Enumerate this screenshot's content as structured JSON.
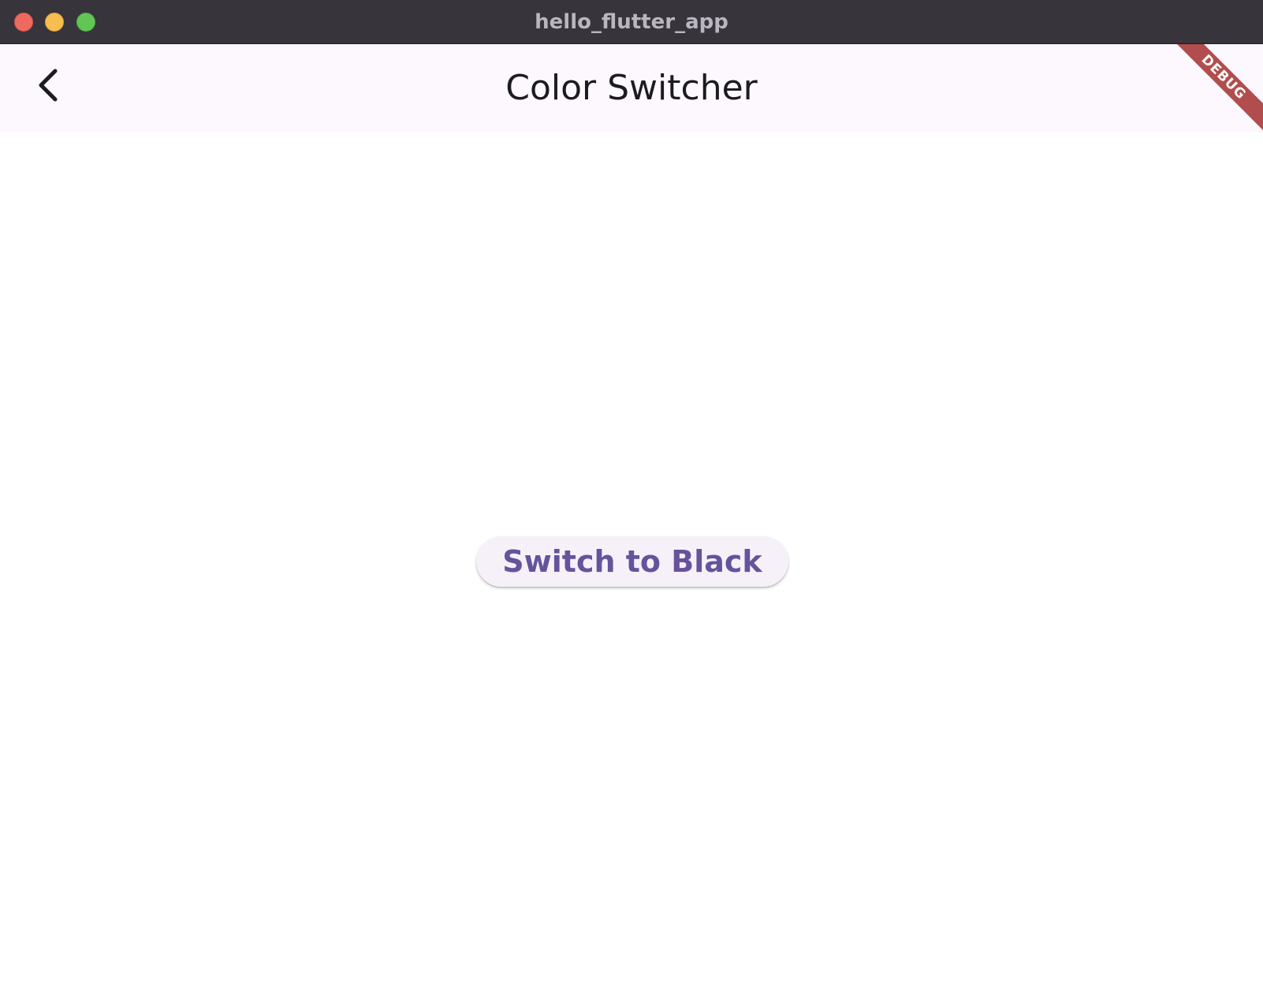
{
  "window": {
    "title": "hello_flutter_app"
  },
  "appbar": {
    "title": "Color Switcher",
    "back_icon": "chevron-left-icon"
  },
  "debug_banner": {
    "label": "DEBUG",
    "color": "#a4312f"
  },
  "main": {
    "button_label": "Switch to Black",
    "button_text_color": "#65539c",
    "button_background": "#f6f1f9"
  },
  "colors": {
    "titlebar": "#37343c",
    "appbar_background": "#fdf8fd",
    "body_background": "#ffffff",
    "traffic_close": "#ee6a5f",
    "traffic_minimize": "#f5be4f",
    "traffic_zoom": "#62c655"
  }
}
